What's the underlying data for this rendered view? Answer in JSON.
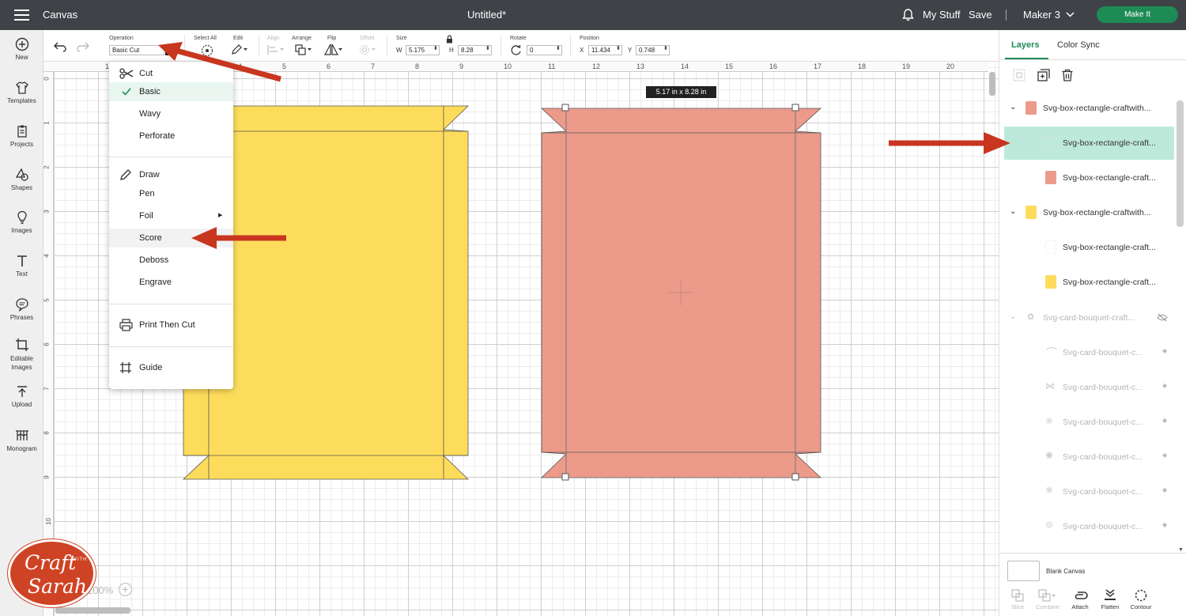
{
  "topbar": {
    "app_title": "Canvas",
    "doc_title": "Untitled*",
    "my_stuff": "My Stuff",
    "save": "Save",
    "machine": "Maker 3",
    "make_it": "Make It"
  },
  "leftnav": [
    {
      "label": "New",
      "icon": "plus-circle-icon"
    },
    {
      "label": "Templates",
      "icon": "shirt-icon"
    },
    {
      "label": "Projects",
      "icon": "clipboard-icon"
    },
    {
      "label": "Shapes",
      "icon": "shapes-icon"
    },
    {
      "label": "Images",
      "icon": "lightbulb-icon"
    },
    {
      "label": "Text",
      "icon": "text-t-icon"
    },
    {
      "label": "Phrases",
      "icon": "speech-bubble-icon"
    },
    {
      "label": "Editable Images",
      "icon": "crop-image-icon"
    },
    {
      "label": "Upload",
      "icon": "upload-icon"
    },
    {
      "label": "Monogram",
      "icon": "monogram-icon"
    }
  ],
  "toolbar": {
    "operation_label": "Operation",
    "operation_value": "Basic Cut",
    "select_all": "Select All",
    "edit": "Edit",
    "align": "Align",
    "arrange": "Arrange",
    "flip": "Flip",
    "offset": "Offset",
    "size": "Size",
    "w_label": "W",
    "w_value": "5.175",
    "h_label": "H",
    "h_value": "8.28",
    "rotate": "Rotate",
    "rotate_value": "0",
    "position": "Position",
    "x_label": "X",
    "x_value": "11.434",
    "y_label": "Y",
    "y_value": "0.748"
  },
  "ruler_top": [
    "1",
    "2",
    "3",
    "4",
    "5",
    "6",
    "7",
    "8",
    "9",
    "10",
    "11",
    "12",
    "13",
    "14",
    "15",
    "16",
    "17",
    "18",
    "19",
    "20"
  ],
  "ruler_left": [
    "0",
    "1",
    "2",
    "3",
    "4",
    "5",
    "6",
    "7",
    "8",
    "9",
    "10"
  ],
  "dropdown": {
    "cut_header": "Cut",
    "basic": "Basic",
    "wavy": "Wavy",
    "perforate": "Perforate",
    "draw_header": "Draw",
    "pen": "Pen",
    "foil": "Foil",
    "score": "Score",
    "deboss": "Deboss",
    "engrave": "Engrave",
    "print_then_cut": "Print Then Cut",
    "guide": "Guide"
  },
  "canvas": {
    "size_tooltip": "5.17  in x 8.28  in",
    "zoom": "100%"
  },
  "colors": {
    "yellow": "#fddc5c",
    "salmon": "#ec9a8a",
    "accent": "#1d8b55",
    "arrow": "#c8361f"
  },
  "rightpanel": {
    "tab_layers": "Layers",
    "tab_color_sync": "Color Sync",
    "layers": [
      {
        "name": "Svg-box-rectangle-craftwith...",
        "swatch": "#ec9a8a",
        "level": 0
      },
      {
        "name": "Svg-box-rectangle-craft...",
        "swatch": "none",
        "level": 1,
        "selected": true
      },
      {
        "name": "Svg-box-rectangle-craft...",
        "swatch": "#ec9a8a",
        "level": 1
      },
      {
        "name": "Svg-box-rectangle-craftwith...",
        "swatch": "#fddc5c",
        "level": 0
      },
      {
        "name": "Svg-box-rectangle-craft...",
        "swatch": "none",
        "level": 1
      },
      {
        "name": "Svg-box-rectangle-craft...",
        "swatch": "#fddc5c",
        "level": 1
      },
      {
        "name": "Svg-card-bouquet-craft...",
        "swatch": "none",
        "level": 0,
        "hidden": true
      },
      {
        "name": "Svg-card-bouquet-c...",
        "swatch": "none",
        "level": 1,
        "hidden": true
      },
      {
        "name": "Svg-card-bouquet-c...",
        "swatch": "none",
        "level": 1,
        "hidden": true
      },
      {
        "name": "Svg-card-bouquet-c...",
        "swatch": "none",
        "level": 1,
        "hidden": true
      },
      {
        "name": "Svg-card-bouquet-c...",
        "swatch": "none",
        "level": 1,
        "hidden": true
      },
      {
        "name": "Svg-card-bouquet-c...",
        "swatch": "none",
        "level": 1,
        "hidden": true
      },
      {
        "name": "Svg-card-bouquet-c...",
        "swatch": "none",
        "level": 1,
        "hidden": true
      }
    ],
    "blank_canvas": "Blank Canvas",
    "tools": [
      "Slice",
      "Combine",
      "Attach",
      "Flatten",
      "Contour"
    ]
  },
  "logo": {
    "text_main": "Craft",
    "text_with": "WITH",
    "text_name": "Sarah"
  }
}
